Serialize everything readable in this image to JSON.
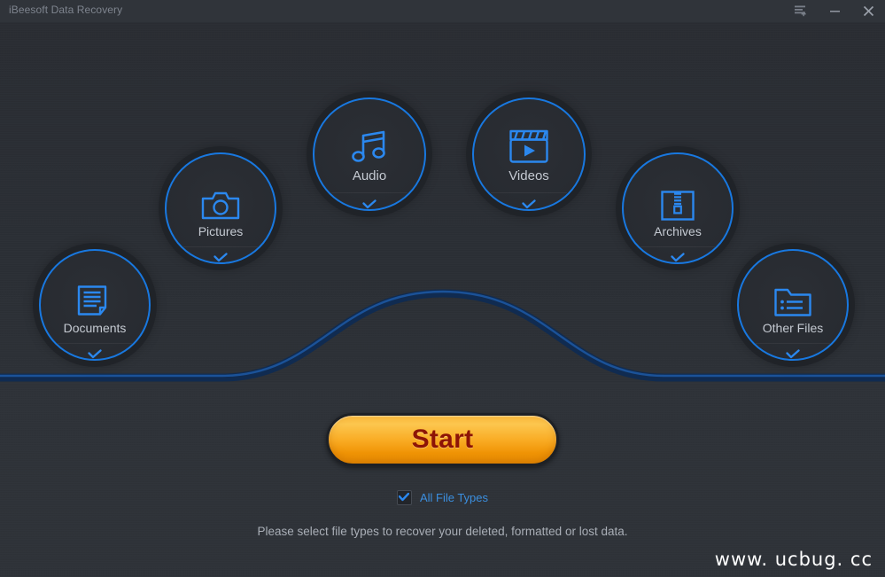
{
  "window": {
    "title": "iBeesoft Data Recovery",
    "controls": [
      {
        "name": "menu-button",
        "icon": "menu-list-plus-icon",
        "label": "Menu"
      },
      {
        "name": "minimize-button",
        "icon": "minimize-icon",
        "label": "Minimize"
      },
      {
        "name": "close-button",
        "icon": "close-icon",
        "label": "Close"
      }
    ]
  },
  "colors": {
    "accent_blue": "#1878e0",
    "icon_blue": "#2b88ef",
    "background": "#2c3036",
    "panel_background": "#2e3238",
    "titlebar": "#30343a",
    "start_orange": "#f9ab23",
    "start_text": "#8d1406",
    "label_gray": "#c5cad2",
    "curve_blue": "#123a6e"
  },
  "file_types": [
    {
      "id": "audio",
      "label": "Audio",
      "icon": "music-note-icon",
      "checked": true,
      "check_glyph": "✓"
    },
    {
      "id": "videos",
      "label": "Videos",
      "icon": "clapperboard-icon",
      "checked": true,
      "check_glyph": "✓"
    },
    {
      "id": "pictures",
      "label": "Pictures",
      "icon": "camera-icon",
      "checked": true,
      "check_glyph": "✓"
    },
    {
      "id": "archives",
      "label": "Archives",
      "icon": "zip-archive-icon",
      "checked": true,
      "check_glyph": "✓"
    },
    {
      "id": "documents",
      "label": "Documents",
      "icon": "document-icon",
      "checked": true,
      "check_glyph": "✓"
    },
    {
      "id": "other",
      "label": "Other Files",
      "icon": "folder-list-icon",
      "checked": true,
      "check_glyph": "✓"
    }
  ],
  "start_button": {
    "label": "Start"
  },
  "all_file_types": {
    "label": "All File Types",
    "checked": true,
    "check_glyph": "✔"
  },
  "hint": {
    "text": "Please select file types to recover your deleted, formatted or lost data."
  },
  "watermark": {
    "text": "www. ucbug. cc"
  }
}
